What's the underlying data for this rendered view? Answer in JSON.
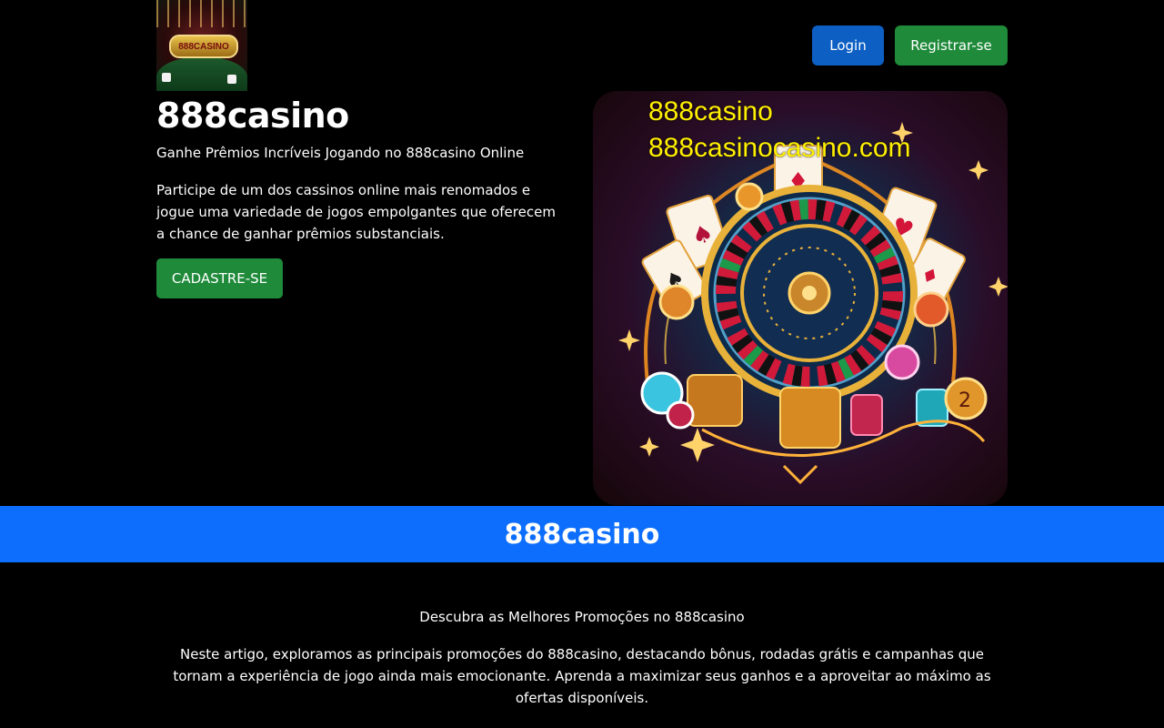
{
  "header": {
    "logo_text": "888CASINO",
    "login_label": "Login",
    "register_label": "Registrar-se"
  },
  "hero": {
    "title": "888casino",
    "subtitle": "Ganhe Prêmios Incríveis Jogando no 888casino Online",
    "description": "Participe de um dos cassinos online mais renomados e jogue uma variedade de jogos empolgantes que oferecem a chance de ganhar prêmios substanciais.",
    "cta_label": "CADASTRE-SE",
    "image_text_line1": "888casino",
    "image_text_line2": "888casinocasino.com"
  },
  "banner": {
    "title": "888casino"
  },
  "article": {
    "title": "Descubra as Melhores Promoções no 888casino",
    "body": "Neste artigo, exploramos as principais promoções do 888casino, destacando bônus, rodadas grátis e campanhas que tornam a experiência de jogo ainda mais emocionante. Aprenda a maximizar seus ganhos e a aproveitar ao máximo as ofertas disponíveis."
  },
  "colors": {
    "background": "#000000",
    "login_button": "#0d5fc4",
    "register_button": "#1f8a3a",
    "banner": "#0d6efd",
    "image_text": "#ffef00"
  }
}
